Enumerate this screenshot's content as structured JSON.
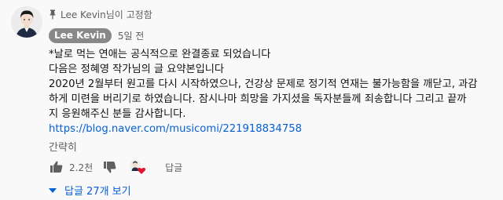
{
  "comment": {
    "pinned_label": "Lee Kevin님이 고정함",
    "author": "Lee Kevin",
    "time": "5일 전",
    "lines": [
      "*날로 먹는 연애는 공식적으로 완결종료 되었습니다",
      "다음은 정혜영 작가님의 글 요약본입니다",
      "2020년 2월부터 원고를 다시 시작하였으나, 건강상 문제로 정기적 연재는 불가능함을 깨닫고, 과감",
      "하게 미련을 버리기로 하였습니다. 잠시나마 희망을 가지셨을 독자분들께 죄송합니다 그리고 끝까",
      "지 응원해주신 분들 감사합니다."
    ],
    "link": "https://blog.naver.com/musicomi/221918834758",
    "collapse_label": "간략히",
    "like_count": "2.2천",
    "reply_label": "답글",
    "view_replies": "답글 27개 보기"
  },
  "icons": {
    "pin": "pin-icon",
    "like": "thumbs-up-icon",
    "dislike": "thumbs-down-icon",
    "heart": "creator-heart-icon",
    "expand": "caret-down-icon"
  },
  "colors": {
    "link": "#065fd4",
    "heart": "#e0182d",
    "chip": "#888888"
  }
}
